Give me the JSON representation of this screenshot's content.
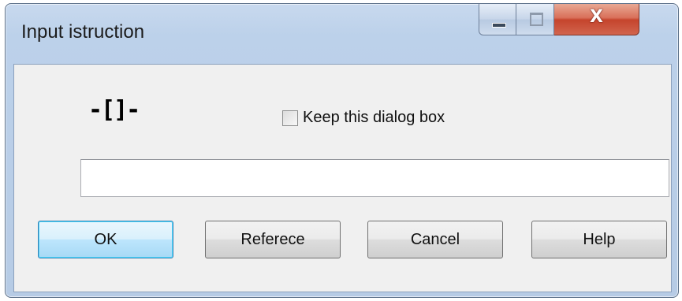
{
  "window": {
    "title": "Input istruction",
    "close_glyph": "X",
    "icons": [
      "minimize-icon",
      "maximize-icon",
      "close-icon"
    ]
  },
  "instruction": {
    "icon_text": "-[]-",
    "icon_name": "ladder-instruction-icon"
  },
  "keep_dialog": {
    "label": "Keep this dialog box",
    "checked": false
  },
  "input": {
    "value": "",
    "placeholder": ""
  },
  "buttons": {
    "ok": "OK",
    "reference": "Referece",
    "cancel": "Cancel",
    "help": "Help"
  },
  "colors": {
    "accent": "#3c7fb1",
    "close": "#c5442c",
    "frame": "#bcd1ea"
  }
}
